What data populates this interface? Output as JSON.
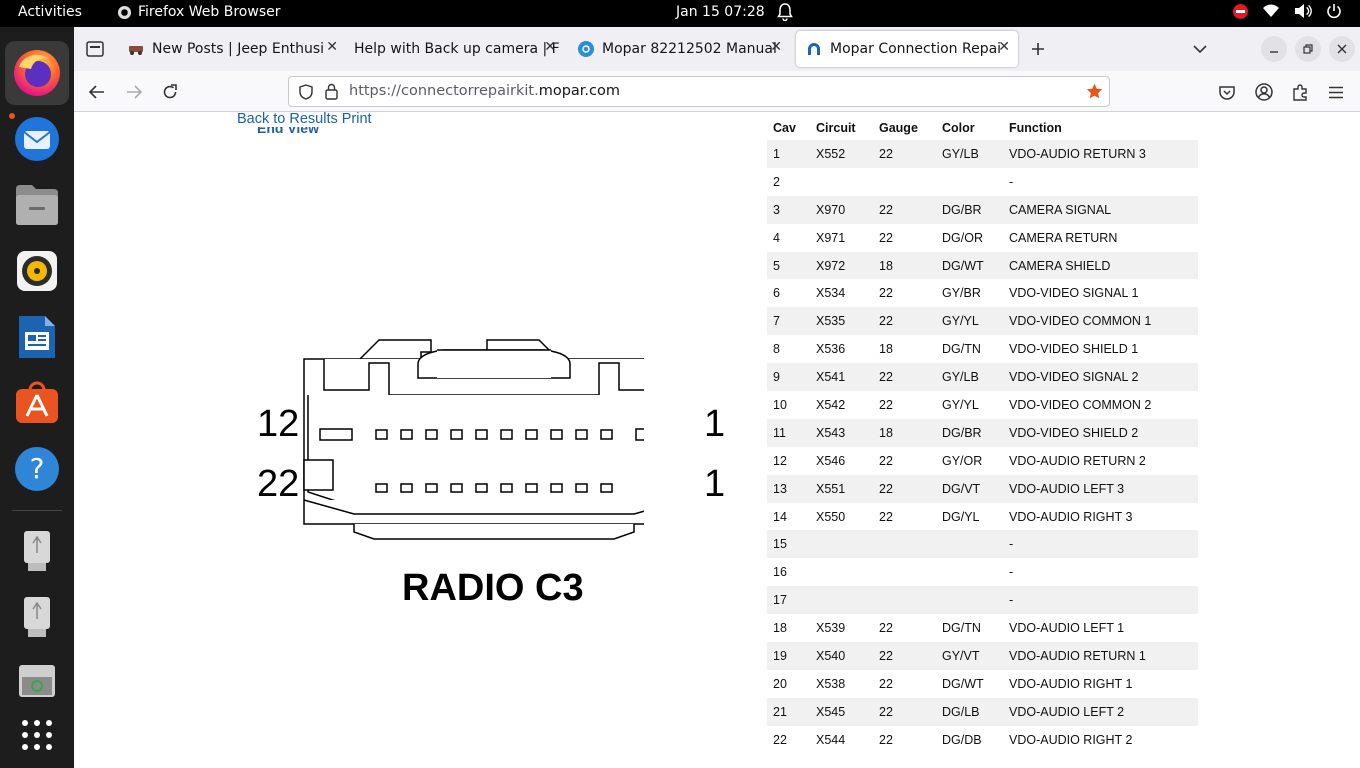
{
  "system": {
    "activities": "Activities",
    "app_name": "Firefox Web Browser",
    "clock": "Jan 15  07:28"
  },
  "dock": {
    "apps": [
      "firefox-icon",
      "thunderbird-icon",
      "files-icon",
      "rhythmbox-icon",
      "libreoffice-writer-icon",
      "ubuntu-software-icon",
      "help-icon",
      "usb-drive-icon",
      "usb-drive-icon",
      "trash-icon",
      "show-apps-icon"
    ]
  },
  "browser": {
    "tabs": [
      {
        "title": "New Posts | Jeep Enthusi"
      },
      {
        "title": "Help with Back up camera | F"
      },
      {
        "title": "Mopar 82212502 Manual"
      },
      {
        "title": "Mopar Connection Repai"
      }
    ],
    "url_prefix": "https://connectorrepairkit.",
    "url_domain": "mopar.com"
  },
  "page": {
    "back_links": "Back to Results Print",
    "end_view": "End View",
    "connector": {
      "title": "RADIO C3",
      "top_left": "12",
      "top_right": "1",
      "bottom_left": "22",
      "bottom_right": "1"
    },
    "table": {
      "headers": [
        "Cav",
        "Circuit",
        "Gauge",
        "Color",
        "Function"
      ],
      "rows": [
        [
          "1",
          "X552",
          "22",
          "GY/LB",
          "VDO-AUDIO RETURN 3"
        ],
        [
          "2",
          "",
          "",
          "",
          "-"
        ],
        [
          "3",
          "X970",
          "22",
          "DG/BR",
          "CAMERA SIGNAL"
        ],
        [
          "4",
          "X971",
          "22",
          "DG/OR",
          "CAMERA RETURN"
        ],
        [
          "5",
          "X972",
          "18",
          "DG/WT",
          "CAMERA SHIELD"
        ],
        [
          "6",
          "X534",
          "22",
          "GY/BR",
          "VDO-VIDEO SIGNAL 1"
        ],
        [
          "7",
          "X535",
          "22",
          "GY/YL",
          "VDO-VIDEO COMMON 1"
        ],
        [
          "8",
          "X536",
          "18",
          "DG/TN",
          "VDO-VIDEO SHIELD 1"
        ],
        [
          "9",
          "X541",
          "22",
          "GY/LB",
          "VDO-VIDEO SIGNAL 2"
        ],
        [
          "10",
          "X542",
          "22",
          "GY/YL",
          "VDO-VIDEO COMMON 2"
        ],
        [
          "11",
          "X543",
          "18",
          "DG/BR",
          "VDO-VIDEO SHIELD 2"
        ],
        [
          "12",
          "X546",
          "22",
          "GY/OR",
          "VDO-AUDIO RETURN 2"
        ],
        [
          "13",
          "X551",
          "22",
          "DG/VT",
          "VDO-AUDIO LEFT 3"
        ],
        [
          "14",
          "X550",
          "22",
          "DG/YL",
          "VDO-AUDIO RIGHT 3"
        ],
        [
          "15",
          "",
          "",
          "",
          "-"
        ],
        [
          "16",
          "",
          "",
          "",
          "-"
        ],
        [
          "17",
          "",
          "",
          "",
          "-"
        ],
        [
          "18",
          "X539",
          "22",
          "DG/TN",
          "VDO-AUDIO LEFT 1"
        ],
        [
          "19",
          "X540",
          "22",
          "GY/VT",
          "VDO-AUDIO RETURN 1"
        ],
        [
          "20",
          "X538",
          "22",
          "DG/WT",
          "VDO-AUDIO RIGHT 1"
        ],
        [
          "21",
          "X545",
          "22",
          "DG/LB",
          "VDO-AUDIO LEFT 2"
        ],
        [
          "22",
          "X544",
          "22",
          "DG/DB",
          "VDO-AUDIO RIGHT 2"
        ]
      ]
    }
  },
  "colors": {
    "ubuntu_orange": "#e95420",
    "link_blue": "#1f5fa8",
    "bookmark_star": "#e8541e"
  }
}
